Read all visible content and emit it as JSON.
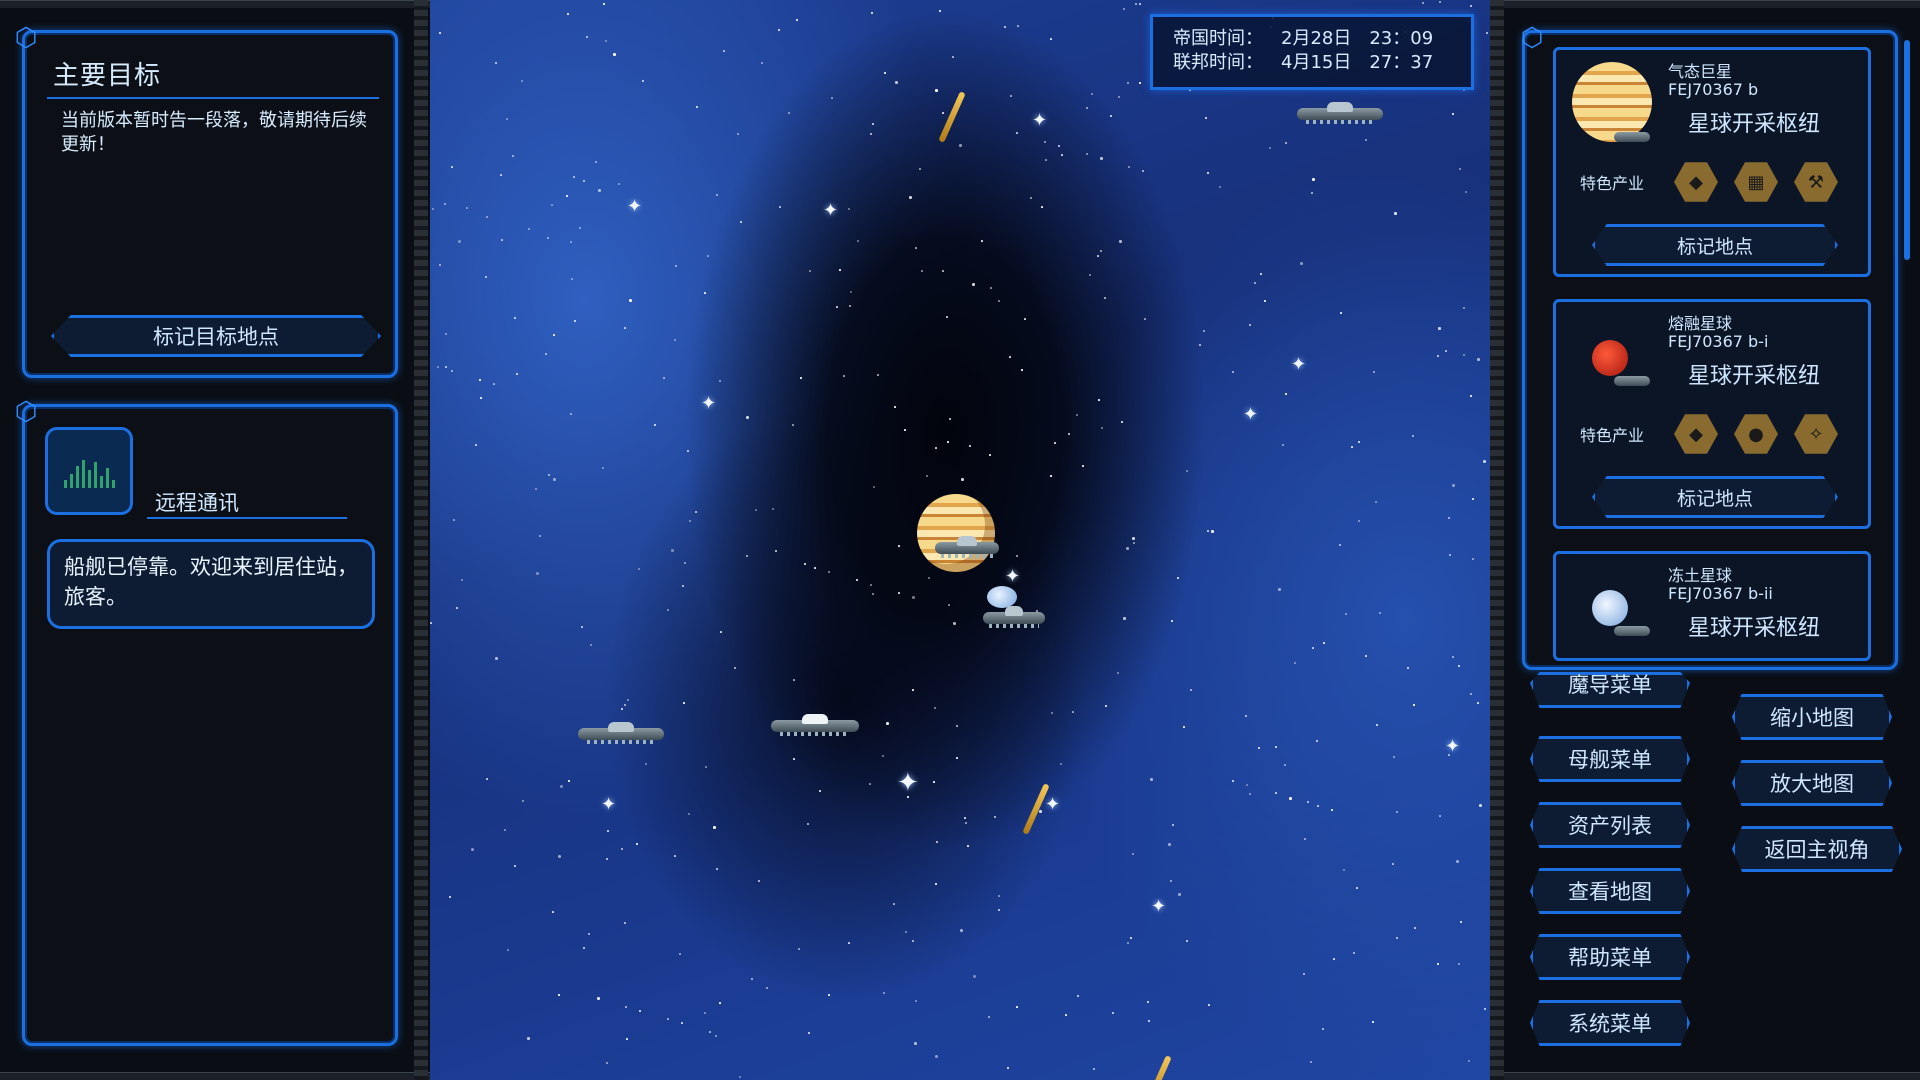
{
  "objective": {
    "title": "主要目标",
    "description": "当前版本暂时告一段落，敬请期待后续更新！",
    "mark_button": "标记目标地点"
  },
  "comms": {
    "title": "远程通讯",
    "message": "船舰已停靠。欢迎来到居住站，旅客。"
  },
  "time": {
    "empire_label": "帝国时间：",
    "empire_date": "2月28日",
    "empire_clock": "23：09",
    "federation_label": "联邦时间：",
    "federation_date": "4月15日",
    "federation_clock": "27：37"
  },
  "planets": [
    {
      "type": "气态巨星",
      "code": "FEJ70367 b",
      "hub": "星球开采枢纽",
      "industry_label": "特色产业",
      "mark": "标记地点",
      "icons": [
        "ore-icon",
        "crate-icon",
        "tool-icon"
      ]
    },
    {
      "type": "熔融星球",
      "code": "FEJ70367 b-i",
      "hub": "星球开采枢纽",
      "industry_label": "特色产业",
      "mark": "标记地点",
      "icons": [
        "ore-icon",
        "rock-icon",
        "crystal-icon"
      ]
    },
    {
      "type": "冻土星球",
      "code": "FEJ70367 b-ii",
      "hub": "星球开采枢纽"
    }
  ],
  "menu": {
    "partial_top": "魔导菜单",
    "mothership": "母舰菜单",
    "assets": "资产列表",
    "view_map": "查看地图",
    "help": "帮助菜单",
    "system": "系统菜单",
    "zoom_out": "缩小地图",
    "zoom_in": "放大地图",
    "return_view": "返回主视角"
  },
  "colors": {
    "accent": "#1b6fe0",
    "panel_bg": "#0c1016",
    "space_blue": "#1d3f95"
  }
}
